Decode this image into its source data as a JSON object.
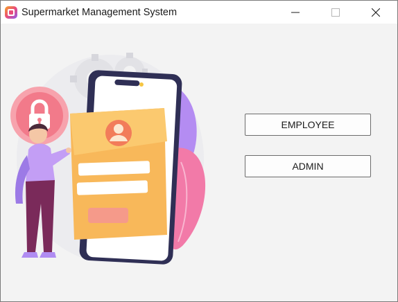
{
  "window": {
    "title": "Supermarket Management System",
    "app_icon": "app-logo-icon",
    "controls": {
      "minimize": "minimize-icon",
      "maximize": "maximize-icon",
      "close": "close-icon"
    }
  },
  "main": {
    "illustration": "login-illustration",
    "buttons": {
      "employee_label": "EMPLOYEE",
      "admin_label": "ADMIN"
    }
  },
  "colors": {
    "window_bg": "#f3f3f3",
    "titlebar_bg": "#ffffff",
    "phone_card": "#f8b85a",
    "accent_purple": "#b48cf2",
    "accent_pink": "#f27aa8"
  }
}
